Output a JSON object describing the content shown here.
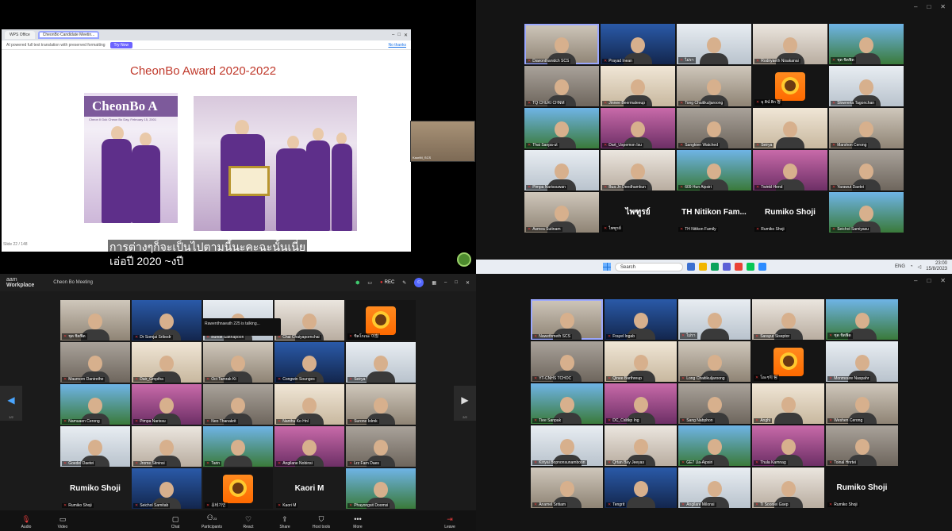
{
  "q1": {
    "browser": {
      "tab1": "WPS Office",
      "tab2": "CheonBo Candidate Meetin...",
      "ai_bar": "AI powered full text translation with preserved formatting",
      "ai_button": "Try Now",
      "ai_link": "No thanks"
    },
    "slide": {
      "title": "CheonBo Award  2020-2022",
      "banner": "CheonBo A",
      "banner_sub": "Cheon Il Guk Cheon Bo Day, February 15, 2001"
    },
    "subtitle_line1": "การต่างๆก็จะเป็นไปตามนี้นะคะฉะนั้นเนี่ย",
    "subtitle_line2": "เอ่อปี 2020 ~งปี",
    "status_left": "Slide 22 / 148",
    "presenter_name": "KaoriM_SCS"
  },
  "q2": {
    "rows": [
      [
        "Dawonthanidch SCS",
        "Prayad Inean",
        "ไม่รา",
        "Rodnyaeth Nisakanai",
        "ชุต ชิตฟิต"
      ],
      [
        "TQ CHUKI CHNM",
        "Jinnee Beermaleeup",
        "Tong Chaitikuljaroong",
        "ธุ คิน์ ฮิก 헝",
        "Slowrerta Tagonchan"
      ],
      [
        "Thai Sanpa-ut",
        "Dart_Uspemon Isu",
        "Sangkien Watched",
        "Seirya",
        "Marshon Cerong"
      ],
      [
        "Pimpa Narissuwan",
        "Bua Jn Deedhamkun",
        "609 Hun Aipsiri",
        "Twinkl Hend",
        "Yarawut Daetei"
      ],
      [
        "Asmea Sutinam",
        "ไพฑูรย์",
        "TH Nitikon Family",
        "Rumiko Shoji",
        "Seichol Samiyasu"
      ]
    ],
    "label_tiles": {
      "paiboon": "ไพฑูรย์",
      "nitikon": "TH Nitikon Fam...",
      "rumiko": "Rumiko  Shoji"
    },
    "sunflower_label": "로어다믿힘",
    "taskbar": {
      "search": "Search",
      "lang": "ENG",
      "time": "23:00",
      "date": "15/8/2023"
    }
  },
  "q3": {
    "brand_top": "aam",
    "brand": "Workplace",
    "meeting": "Cheon Bo Meeting",
    "rec": "REC",
    "tooltip": "Rawenthnaeath 225 is talking...",
    "nav_left_page": "1/2",
    "nav_right_page": "2/2",
    "rows": [
      [
        "ชุต ชิตฟิต",
        "Dr Somjai Sribodr",
        "Bundit Satthapoon",
        "Chai Chaiyapornchai",
        "ขิคโกเนะ 이힐"
      ],
      [
        "Maumorn Danirethe",
        "Dair_Gmptha",
        "Oct Tamrak Kt",
        "Congwin Sounges",
        "Seirya"
      ],
      [
        "Namuaen Cerong",
        "Pimpa Narissu",
        "Neo Thanakrit",
        "Nanthu Ko Hnl",
        "Surone Iolmk"
      ],
      [
        "Goedel Daetei",
        "Jrome Sitninsi",
        "Tarin",
        "Angilane Nobinsi",
        "Lrz Farn Daes"
      ],
      [
        "Rumiko Shoji",
        "Seichol Samitab",
        "웃비기인",
        "Kaori M",
        "Phayongsit Doomsi"
      ]
    ],
    "label_tiles": {
      "rumiko": "Rumiko  Shoji",
      "kaori": "Kaori M"
    },
    "toolbar": {
      "audio": "Audio",
      "video": "Video",
      "chat": "Chat",
      "participants": "Participants",
      "participant_count": "23",
      "react": "React",
      "share": "Share",
      "host_tools": "Host tools",
      "more": "More",
      "leave": "Leave"
    }
  },
  "q4": {
    "rows": [
      [
        "Nawethmeth SCS",
        "Frayel Ingab",
        "ไม่รา",
        "Sarayut Siseptor",
        "ชุต ชิตฟิต"
      ],
      [
        "YT-CNHS TCHOC",
        "Qinee Barthreup",
        "Long Chaitikuljaroong",
        "โอะๆ이 팀",
        "Monmoure Naspahr"
      ],
      [
        "Tiee Sanpak",
        "DC_Cslitkp Ing",
        "Sang Nabphon",
        "Anghi",
        "Weshen Cerong"
      ],
      [
        "Kiriyai Bopnonsunamboon",
        "Qrtan Bay Jeeyas",
        "GE7 Ua-Aipsiri",
        "Thula Kamnag",
        "Toinal Hnrtei"
      ],
      [
        "Anamel Sritiam",
        "Tengrit",
        "Angilare Milonsi",
        "Ti Soonlei Gsep",
        "Rumiko Shoji"
      ]
    ],
    "label_tiles": {
      "rumiko": "Rumiko  Shoji"
    },
    "sunflower_label": "로어다믿힘"
  },
  "colors": {
    "active_outline": "#9aa7ff",
    "muted_mic": "#e23b3b",
    "slide_title": "#c0392b",
    "robe": "#5e2f8a"
  }
}
